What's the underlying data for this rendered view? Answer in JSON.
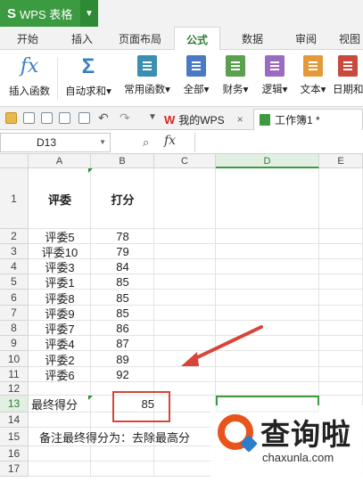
{
  "app": {
    "logo": "S",
    "title": "WPS 表格"
  },
  "ribbon_tabs": [
    "开始",
    "插入",
    "页面布局",
    "公式",
    "数据",
    "审阅",
    "视图"
  ],
  "active_tab": "公式",
  "ribbon_buttons": [
    {
      "label": "插入函数",
      "icon": "fx-icon"
    },
    {
      "label": "自动求和▾",
      "icon": "sigma-icon"
    },
    {
      "label": "常用函数▾",
      "icon": "star-box-icon"
    },
    {
      "label": "全部▾",
      "icon": "list-box-icon"
    },
    {
      "label": "财务▾",
      "icon": "finance-box-icon"
    },
    {
      "label": "逻辑▾",
      "icon": "logic-box-icon"
    },
    {
      "label": "文本▾",
      "icon": "text-box-icon"
    },
    {
      "label": "日期和",
      "icon": "date-box-icon"
    }
  ],
  "doc_tabs": [
    {
      "logo": "W",
      "label": "我的WPS",
      "close": "×"
    },
    {
      "label": "工作簿1 *"
    }
  ],
  "formula_bar": {
    "cell_ref": "D13",
    "fx": "fx",
    "formula": ""
  },
  "columns": [
    "A",
    "B",
    "C",
    "D",
    "E"
  ],
  "rows": [
    "1",
    "2",
    "3",
    "4",
    "5",
    "6",
    "7",
    "8",
    "9",
    "10",
    "11",
    "12",
    "13",
    "14",
    "15",
    "16",
    "17"
  ],
  "header_row": {
    "a": "评委",
    "b": "打分"
  },
  "judges": [
    {
      "name": "评委5",
      "score": "78"
    },
    {
      "name": "评委10",
      "score": "79"
    },
    {
      "name": "评委3",
      "score": "84"
    },
    {
      "name": "评委1",
      "score": "85"
    },
    {
      "name": "评委8",
      "score": "85"
    },
    {
      "name": "评委9",
      "score": "85"
    },
    {
      "name": "评委7",
      "score": "86"
    },
    {
      "name": "评委4",
      "score": "87"
    },
    {
      "name": "评委2",
      "score": "89"
    },
    {
      "name": "评委6",
      "score": "92"
    }
  ],
  "final": {
    "label": "最终得分",
    "value": "85"
  },
  "note": "备注最终得分为：去除最高分",
  "watermark": {
    "title": "查询啦",
    "url": "chaxunla.com"
  }
}
